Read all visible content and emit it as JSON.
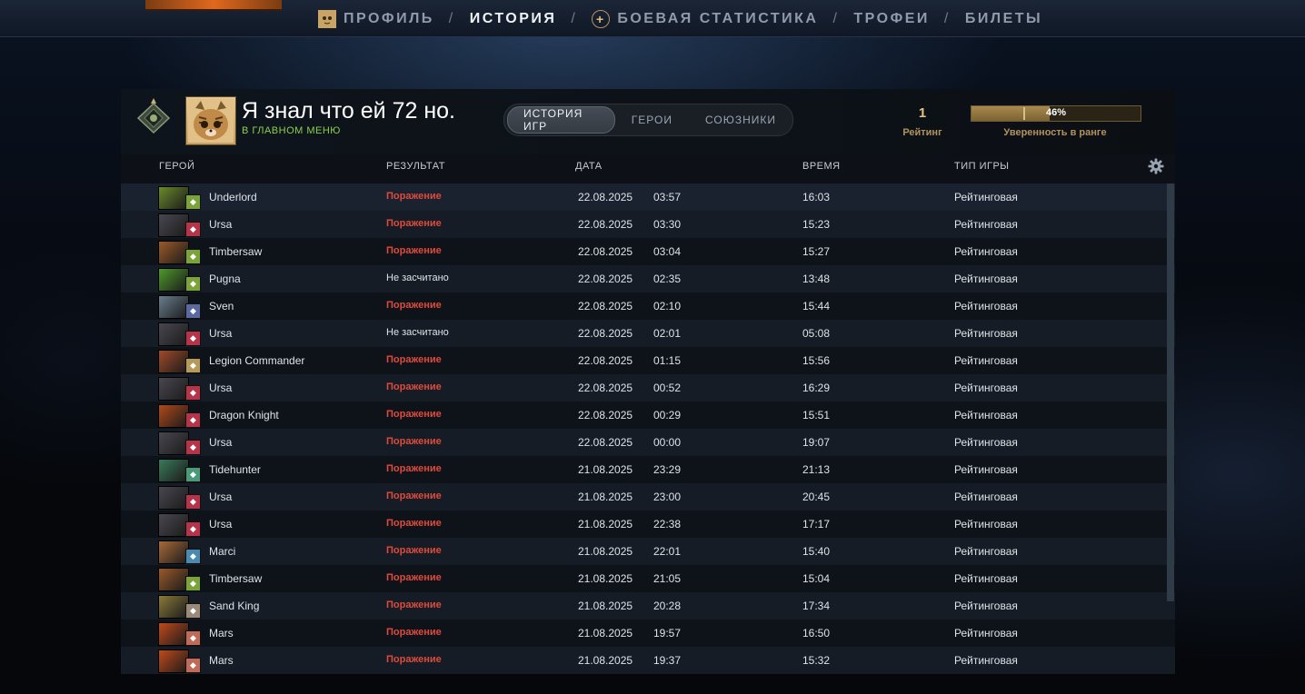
{
  "nav": {
    "items": [
      {
        "label": "ПРОФИЛЬ",
        "icon": "profile-avatar-icon",
        "active": false
      },
      {
        "label": "ИСТОРИЯ",
        "active": true
      },
      {
        "label": "БОЕВАЯ СТАТИСТИКА",
        "icon": "plus-icon",
        "active": false
      },
      {
        "label": "ТРОФЕИ",
        "active": false
      },
      {
        "label": "БИЛЕТЫ",
        "active": false
      }
    ],
    "separator": "/"
  },
  "player": {
    "name": "Я знал что ей 72 но.",
    "status": "В ГЛАВНОМ МЕНЮ"
  },
  "tabs": [
    {
      "label": "ИСТОРИЯ ИГР",
      "active": true
    },
    {
      "label": "ГЕРОИ",
      "active": false
    },
    {
      "label": "СОЮЗНИКИ",
      "active": false
    }
  ],
  "rating": {
    "value": "1",
    "label": "Рейтинг"
  },
  "confidence": {
    "percent": 46,
    "text": "46%",
    "label": "Уверенность в ранге"
  },
  "columns": {
    "hero": "ГЕРОЙ",
    "result": "РЕЗУЛЬТАТ",
    "date": "ДАТА",
    "time": "ВРЕМЯ",
    "mode": "ТИП ИГРЫ"
  },
  "colors": {
    "loss": "#e04a3a",
    "accent_gold": "#b3925e",
    "status_green": "#8ad14b"
  },
  "matches": [
    {
      "hero": "Underlord",
      "result": "Поражение",
      "loss": true,
      "date": "22.08.2025",
      "clock": "03:57",
      "duration": "16:03",
      "mode": "Рейтинговая",
      "hero_color": "#6b8a2a",
      "role_color": "#7aa33a"
    },
    {
      "hero": "Ursa",
      "result": "Поражение",
      "loss": true,
      "date": "22.08.2025",
      "clock": "03:30",
      "duration": "15:23",
      "mode": "Рейтинговая",
      "hero_color": "#4a4850",
      "role_color": "#b5344a"
    },
    {
      "hero": "Timbersaw",
      "result": "Поражение",
      "loss": true,
      "date": "22.08.2025",
      "clock": "03:04",
      "duration": "15:27",
      "mode": "Рейтинговая",
      "hero_color": "#9a5a2a",
      "role_color": "#7aa33a"
    },
    {
      "hero": "Pugna",
      "result": "Не засчитано",
      "loss": false,
      "date": "22.08.2025",
      "clock": "02:35",
      "duration": "13:48",
      "mode": "Рейтинговая",
      "hero_color": "#4f9a2a",
      "role_color": "#7aa33a"
    },
    {
      "hero": "Sven",
      "result": "Поражение",
      "loss": true,
      "date": "22.08.2025",
      "clock": "02:10",
      "duration": "15:44",
      "mode": "Рейтинговая",
      "hero_color": "#6a7e8e",
      "role_color": "#5a6aa0"
    },
    {
      "hero": "Ursa",
      "result": "Не засчитано",
      "loss": false,
      "date": "22.08.2025",
      "clock": "02:01",
      "duration": "05:08",
      "mode": "Рейтинговая",
      "hero_color": "#4a4850",
      "role_color": "#b5344a"
    },
    {
      "hero": "Legion Commander",
      "result": "Поражение",
      "loss": true,
      "date": "22.08.2025",
      "clock": "01:15",
      "duration": "15:56",
      "mode": "Рейтинговая",
      "hero_color": "#a04a2a",
      "role_color": "#b59a5a"
    },
    {
      "hero": "Ursa",
      "result": "Поражение",
      "loss": true,
      "date": "22.08.2025",
      "clock": "00:52",
      "duration": "16:29",
      "mode": "Рейтинговая",
      "hero_color": "#4a4850",
      "role_color": "#b5344a"
    },
    {
      "hero": "Dragon Knight",
      "result": "Поражение",
      "loss": true,
      "date": "22.08.2025",
      "clock": "00:29",
      "duration": "15:51",
      "mode": "Рейтинговая",
      "hero_color": "#b04a1a",
      "role_color": "#b5344a"
    },
    {
      "hero": "Ursa",
      "result": "Поражение",
      "loss": true,
      "date": "22.08.2025",
      "clock": "00:00",
      "duration": "19:07",
      "mode": "Рейтинговая",
      "hero_color": "#4a4850",
      "role_color": "#b5344a"
    },
    {
      "hero": "Tidehunter",
      "result": "Поражение",
      "loss": true,
      "date": "21.08.2025",
      "clock": "23:29",
      "duration": "21:13",
      "mode": "Рейтинговая",
      "hero_color": "#3a7a5a",
      "role_color": "#4a9a7a"
    },
    {
      "hero": "Ursa",
      "result": "Поражение",
      "loss": true,
      "date": "21.08.2025",
      "clock": "23:00",
      "duration": "20:45",
      "mode": "Рейтинговая",
      "hero_color": "#4a4850",
      "role_color": "#b5344a"
    },
    {
      "hero": "Ursa",
      "result": "Поражение",
      "loss": true,
      "date": "21.08.2025",
      "clock": "22:38",
      "duration": "17:17",
      "mode": "Рейтинговая",
      "hero_color": "#4a4850",
      "role_color": "#b5344a"
    },
    {
      "hero": "Marci",
      "result": "Поражение",
      "loss": true,
      "date": "21.08.2025",
      "clock": "22:01",
      "duration": "15:40",
      "mode": "Рейтинговая",
      "hero_color": "#a86a3a",
      "role_color": "#4a8ab0"
    },
    {
      "hero": "Timbersaw",
      "result": "Поражение",
      "loss": true,
      "date": "21.08.2025",
      "clock": "21:05",
      "duration": "15:04",
      "mode": "Рейтинговая",
      "hero_color": "#9a5a2a",
      "role_color": "#7aa33a"
    },
    {
      "hero": "Sand King",
      "result": "Поражение",
      "loss": true,
      "date": "21.08.2025",
      "clock": "20:28",
      "duration": "17:34",
      "mode": "Рейтинговая",
      "hero_color": "#8a7a3a",
      "role_color": "#9a8a7a"
    },
    {
      "hero": "Mars",
      "result": "Поражение",
      "loss": true,
      "date": "21.08.2025",
      "clock": "19:57",
      "duration": "16:50",
      "mode": "Рейтинговая",
      "hero_color": "#c04a1a",
      "role_color": "#c06a5a"
    },
    {
      "hero": "Mars",
      "result": "Поражение",
      "loss": true,
      "date": "21.08.2025",
      "clock": "19:37",
      "duration": "15:32",
      "mode": "Рейтинговая",
      "hero_color": "#c04a1a",
      "role_color": "#c06a5a"
    }
  ]
}
